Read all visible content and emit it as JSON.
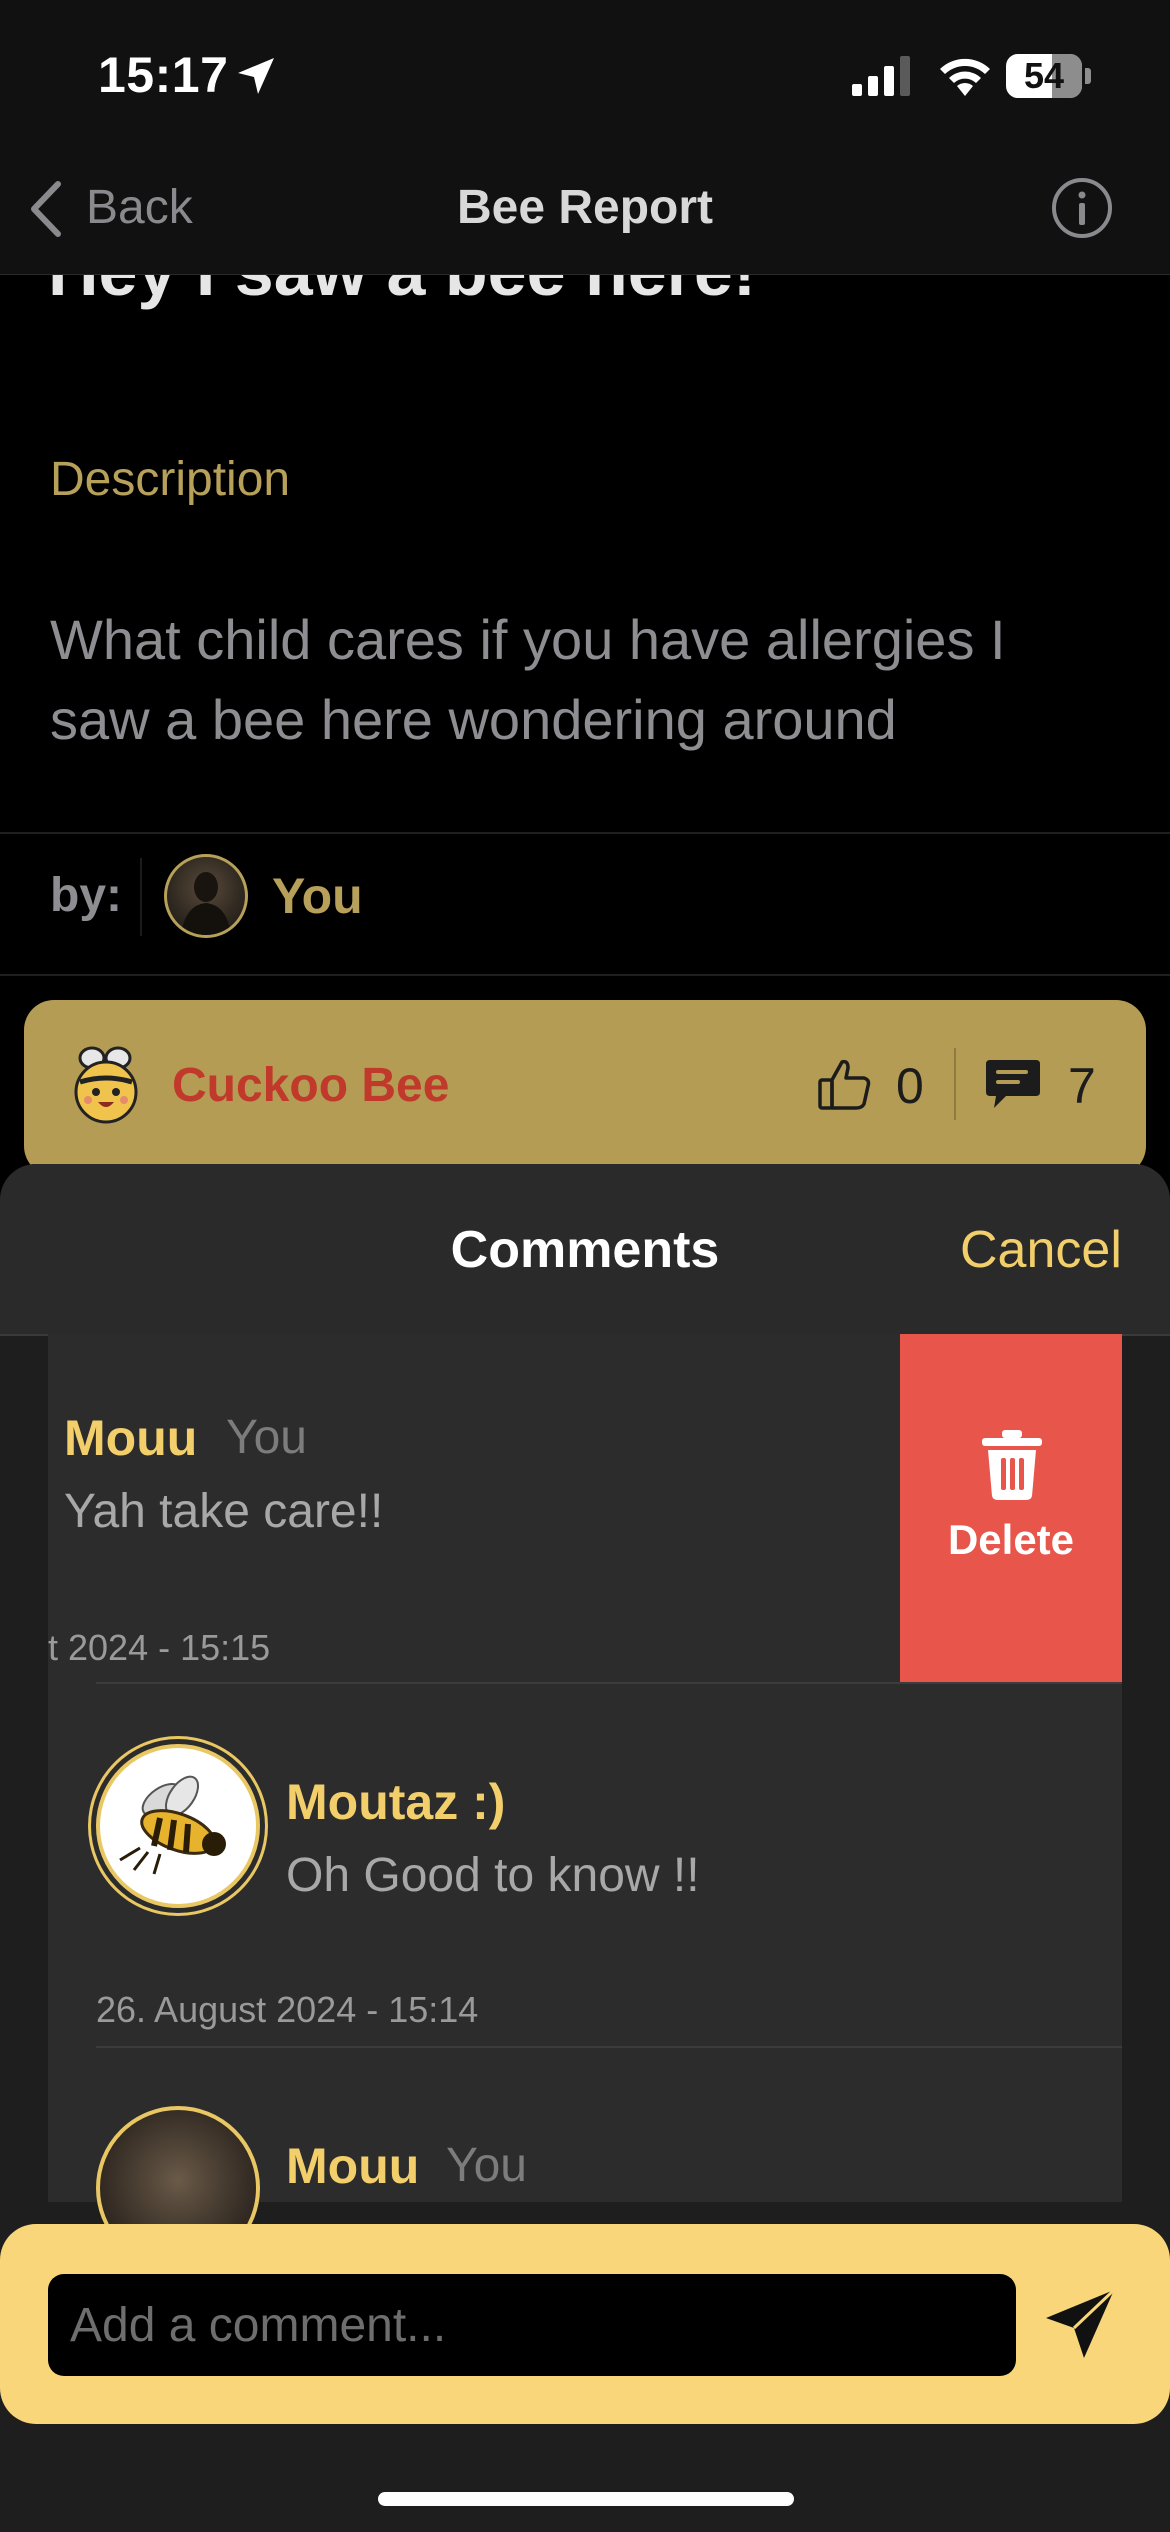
{
  "status_bar": {
    "time": "15:17",
    "battery": "54"
  },
  "nav": {
    "back_label": "Back",
    "title": "Bee Report"
  },
  "report": {
    "title": "Hey I saw a bee here!",
    "description_heading": "Description",
    "description": "What child cares if you have allergies I saw a bee here wondering around",
    "by_label": "by:",
    "author": "You"
  },
  "bee_card": {
    "species": "Cuckoo Bee",
    "likes": "0",
    "comments": "7"
  },
  "comments_sheet": {
    "title": "Comments",
    "cancel_label": "Cancel",
    "delete_label": "Delete",
    "items": [
      {
        "name": "Mouu",
        "badge": "You",
        "text": "Yah take care!!",
        "date": "t 2024 - 15:15"
      },
      {
        "name": "Moutaz :)",
        "text": "Oh Good to know !!",
        "date": "26. August 2024 - 15:14"
      },
      {
        "name": "Mouu",
        "badge": "You"
      }
    ]
  },
  "compose": {
    "placeholder": "Add a comment..."
  },
  "colors": {
    "accent": "#f2cf6b",
    "card": "#b49c55",
    "delete": "#e8554a",
    "species": "#c0392b"
  }
}
